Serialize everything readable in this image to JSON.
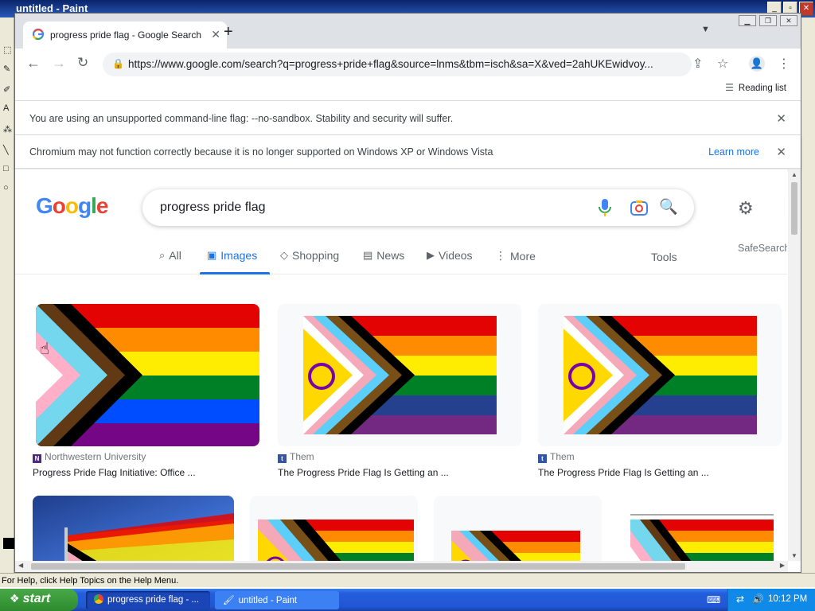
{
  "paint": {
    "title": "untitled - Paint",
    "status": "For Help, click Help Topics on the Help Menu."
  },
  "chrome": {
    "tab_title": "progress pride flag - Google Search",
    "url": "https://www.google.com/search?q=progress+pride+flag&source=lnms&tbm=isch&sa=X&ved=2ahUKEwidvoy...",
    "reading_list": "Reading list",
    "infobar1": "You are using an unsupported command-line flag: --no-sandbox. Stability and security will suffer.",
    "infobar2": "Chromium may not function correctly because it is no longer supported on Windows XP or Windows Vista",
    "learn_more": "Learn more"
  },
  "search": {
    "query": "progress pride flag",
    "tabs": [
      "All",
      "Images",
      "Shopping",
      "News",
      "Videos",
      "More"
    ],
    "tools": "Tools",
    "safesearch": "SafeSearch"
  },
  "results": [
    {
      "source": "Northwestern University",
      "caption": "Progress Pride Flag Initiative: Office ..."
    },
    {
      "source": "Them",
      "caption": "The Progress Pride Flag Is Getting an ..."
    },
    {
      "source": "Them",
      "caption": "The Progress Pride Flag Is Getting an ..."
    }
  ],
  "taskbar": {
    "start": "start",
    "task1": "progress pride flag - ...",
    "task2": "untitled - Paint",
    "clock": "10:12 PM"
  },
  "colors": {
    "accent": "#1a73e8",
    "xp_blue": "#245edc",
    "start_green": "#3a9b3a"
  }
}
